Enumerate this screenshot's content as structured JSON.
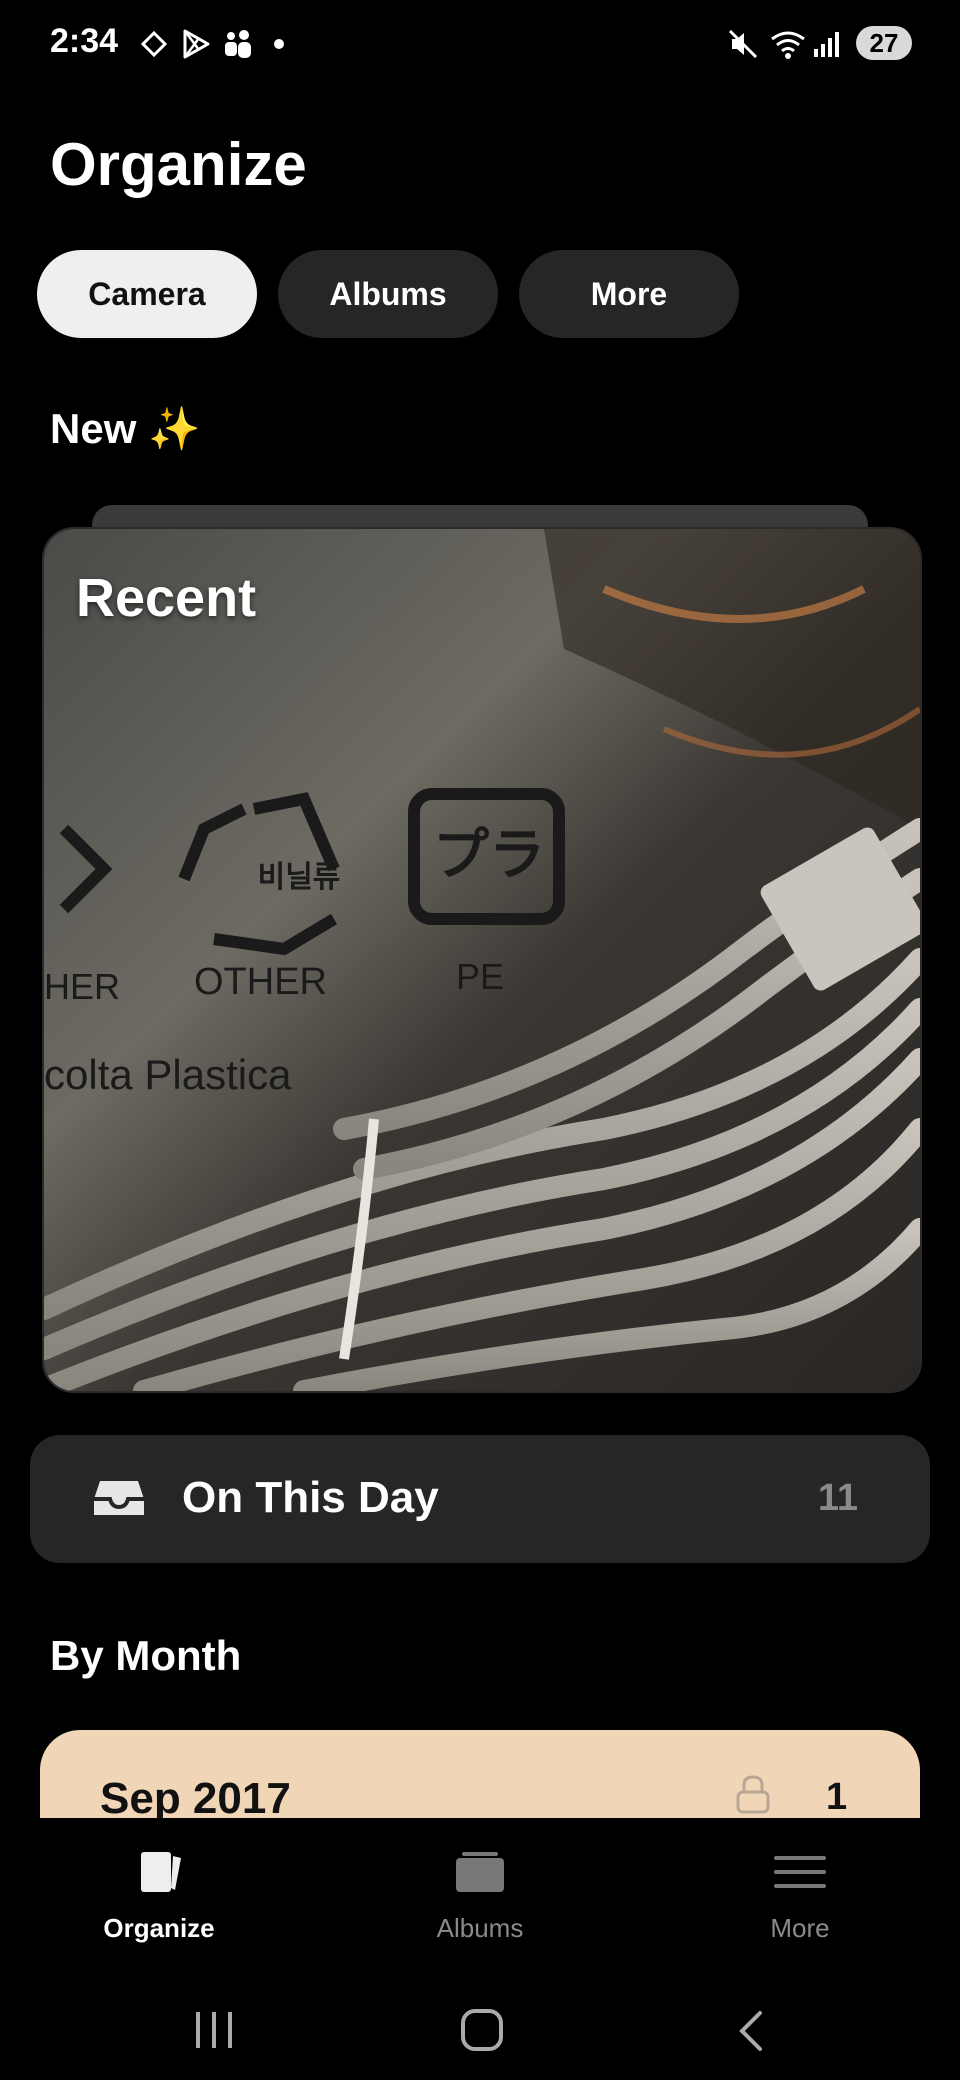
{
  "status_bar": {
    "time": "2:34",
    "battery": "27"
  },
  "page": {
    "title": "Organize"
  },
  "tabs": [
    {
      "label": "Camera",
      "active": true
    },
    {
      "label": "Albums",
      "active": false
    },
    {
      "label": "More",
      "active": false
    }
  ],
  "new_section": {
    "title": "New ✨"
  },
  "recent_card": {
    "title": "Recent",
    "photo_text": {
      "other1": "HER",
      "other2": "OTHER",
      "pe": "PE",
      "korean": "비닐류",
      "pla": "プラ",
      "plastica": "colta Plastica"
    }
  },
  "on_this_day": {
    "label": "On This Day",
    "count": "11"
  },
  "by_month": {
    "title": "By Month",
    "items": [
      {
        "label": "Sep 2017",
        "count": "1"
      }
    ]
  },
  "bottom_nav": [
    {
      "label": "Organize",
      "icon": "organize-icon",
      "active": true
    },
    {
      "label": "Albums",
      "icon": "albums-icon",
      "active": false
    },
    {
      "label": "More",
      "icon": "menu-icon",
      "active": false
    }
  ],
  "colors": {
    "background": "#000000",
    "card": "#262626",
    "month_card": "#f1d5b7",
    "active_tab": "#efefef"
  }
}
